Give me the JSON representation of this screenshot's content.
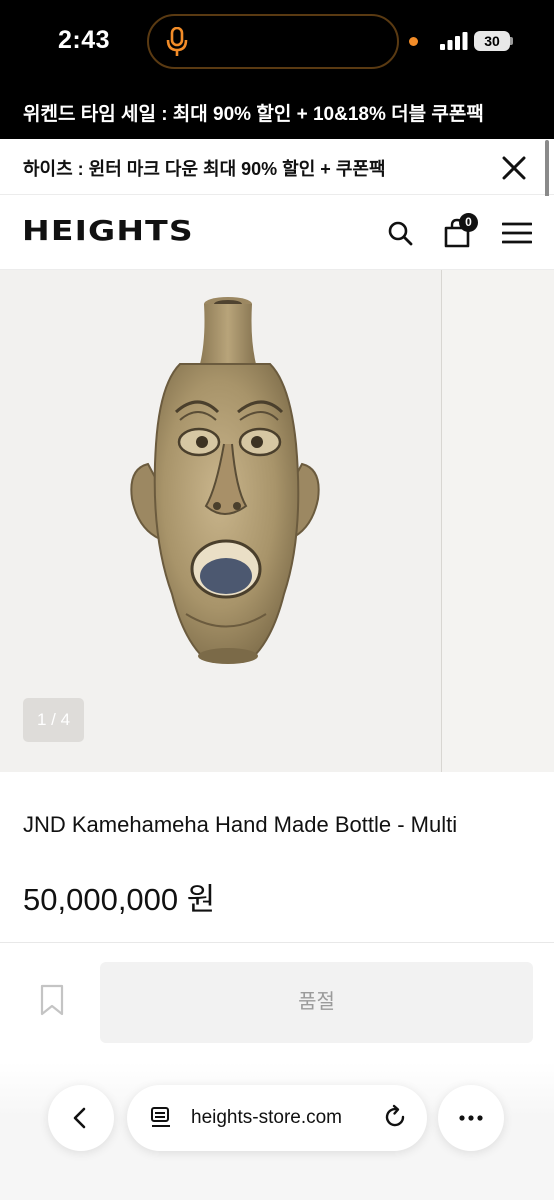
{
  "status_bar": {
    "time": "2:43",
    "battery_level": "30",
    "icons": [
      "microphone-icon",
      "signal-icon",
      "battery-icon"
    ],
    "mic_color": "#f28c28",
    "indicator_dot_color": "#f28c28"
  },
  "sale_banner": {
    "text": "위켄드 타임 세일 : 최대 90% 할인 + 10&18% 더블 쿠폰팩"
  },
  "promo_bar": {
    "text": "하이츠 : 윈터 마크 다운 최대 90% 할인 + 쿠폰팩",
    "close_icon": "close-icon"
  },
  "header": {
    "logo": "HEIGHTS",
    "cart_count": "0",
    "icons": [
      "search-icon",
      "cart-icon",
      "menu-icon"
    ]
  },
  "gallery": {
    "image_alt": "JND Kamehameha Hand Made Bottle - Multi",
    "page_indicator": "1 / 4",
    "current_index": 1,
    "total": 4
  },
  "product": {
    "name": "JND Kamehameha Hand Made Bottle - Multi",
    "price": "50,000,000 원"
  },
  "purchase": {
    "bookmark_icon": "bookmark-icon",
    "soldout_label": "품절"
  },
  "browser": {
    "url": "heights-store.com",
    "icons": [
      "back-icon",
      "reader-icon",
      "reload-icon",
      "more-icon"
    ]
  },
  "colors": {
    "banner_bg": "#000000",
    "accent_orange": "#f28c28",
    "gallery_bg": "#f2f1ef",
    "disabled_text": "#9b9b9b"
  }
}
